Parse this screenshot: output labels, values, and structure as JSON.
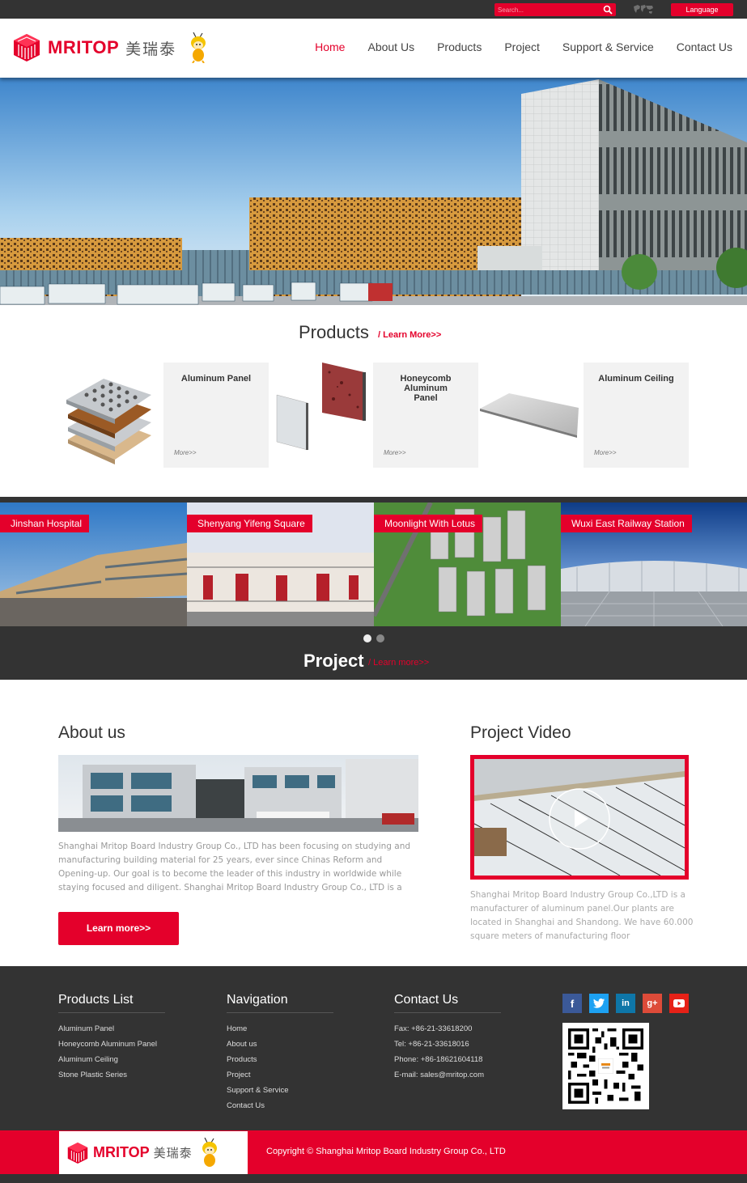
{
  "topbar": {
    "search_placeholder": "Search...",
    "language_label": "Language"
  },
  "header": {
    "brand": "MRITOP",
    "brand_cn": "美瑞泰",
    "nav": [
      {
        "label": "Home",
        "active": true
      },
      {
        "label": "About Us"
      },
      {
        "label": "Products"
      },
      {
        "label": "Project"
      },
      {
        "label": "Support & Service"
      },
      {
        "label": "Contact Us"
      }
    ]
  },
  "products": {
    "title": "Products",
    "learn_more": "/ Learn More>>",
    "items": [
      {
        "name": "Aluminum Panel",
        "more": "More>>"
      },
      {
        "name": "Honeycomb Aluminum Panel",
        "more": "More>>"
      },
      {
        "name": "Aluminum Ceiling",
        "more": "More>>"
      }
    ]
  },
  "projects": {
    "title": "Project",
    "learn_more": "/ Learn more>>",
    "items": [
      {
        "label": "Jinshan Hospital"
      },
      {
        "label": "Shenyang Yifeng Square"
      },
      {
        "label": "Moonlight With Lotus"
      },
      {
        "label": "Wuxi East Railway Station"
      }
    ],
    "carousel_pages": 2,
    "carousel_active": 1
  },
  "about": {
    "title": "About us",
    "text": "Shanghai Mritop Board Industry Group Co., LTD has been focusing on studying and manufacturing building material for 25 years, ever since Chinas Reform and Opening-up. Our goal is to become the leader of this industry in worldwide while staying focused and diligent. Shanghai Mritop Board Industry Group Co., LTD is a",
    "button": "Learn more>>"
  },
  "video": {
    "title": "Project Video",
    "text": "Shanghai Mritop Board Industry Group Co.,LTD is a manufacturer of aluminum panel.Our plants are located in Shanghai and Shandong. We have 60.000 square meters of manufacturing floor"
  },
  "footer": {
    "products_list": {
      "title": "Products List",
      "items": [
        "Aluminum Panel",
        "Honeycomb Aluminum Panel",
        "Aluminum Ceiling",
        "Stone Plastic Series"
      ]
    },
    "navigation": {
      "title": "Navigation",
      "items": [
        "Home",
        "About us",
        "Products",
        "Project",
        "Support & Service",
        "Contact Us"
      ]
    },
    "contact": {
      "title": "Contact Us",
      "items": [
        "Fax: +86-21-33618200",
        "Tel: +86-21-33618016",
        "Phone: +86-18621604118",
        "E-mail: sales@mritop.com"
      ]
    },
    "social": [
      {
        "icon": "facebook-icon",
        "glyph": "f",
        "color": "#3b5998"
      },
      {
        "icon": "twitter-icon",
        "glyph": "t",
        "color": "#1da1f2"
      },
      {
        "icon": "linkedin-icon",
        "glyph": "in",
        "color": "#0e76a8"
      },
      {
        "icon": "google-plus-icon",
        "glyph": "g+",
        "color": "#dd4b39"
      },
      {
        "icon": "youtube-icon",
        "glyph": "▶",
        "color": "#e62117"
      }
    ],
    "copyright": "Copyright © Shanghai Mritop Board Industry Group Co., LTD"
  },
  "colors": {
    "accent": "#e4002b",
    "dark": "#333333"
  }
}
